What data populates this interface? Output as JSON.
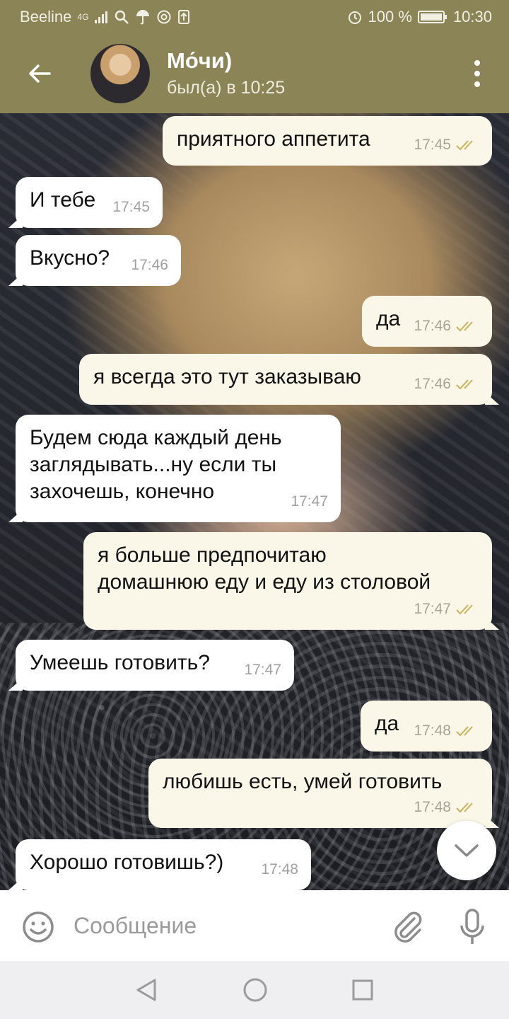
{
  "statusbar": {
    "carrier": "Beeline",
    "network": "4G",
    "battery": "100 %",
    "time": "10:30"
  },
  "header": {
    "title": "Мо́чи)",
    "status": "был(а) в 10:25"
  },
  "messages": [
    {
      "dir": "out",
      "text": "приятного аппетита",
      "time": "17:45"
    },
    {
      "dir": "in",
      "text": "И тебе",
      "time": "17:45"
    },
    {
      "dir": "in",
      "text": "Вкусно?",
      "time": "17:46"
    },
    {
      "dir": "out",
      "text": "да",
      "time": "17:46"
    },
    {
      "dir": "out",
      "text": "я всегда это тут заказываю",
      "time": "17:46"
    },
    {
      "dir": "in",
      "text": "Будем сюда каждый день\nзаглядывать...ну если ты\nзахочешь, конечно",
      "time": "17:47"
    },
    {
      "dir": "out",
      "text": "я больше предпочитаю\nдомашнюю еду и еду из столовой",
      "time": "17:47"
    },
    {
      "dir": "in",
      "text": "Умеешь готовить?",
      "time": "17:47"
    },
    {
      "dir": "out",
      "text": "да",
      "time": "17:48"
    },
    {
      "dir": "out",
      "text": "любишь есть, умей готовить",
      "time": "17:48"
    },
    {
      "dir": "in",
      "text": "Хорошо готовишь?)",
      "time": "17:48"
    }
  ],
  "input": {
    "placeholder": "Сообщение"
  },
  "colors": {
    "header": "#8a8457",
    "bubble_out": "#fbf7e8",
    "bubble_in": "#ffffff",
    "checks": "#c9b25a"
  }
}
